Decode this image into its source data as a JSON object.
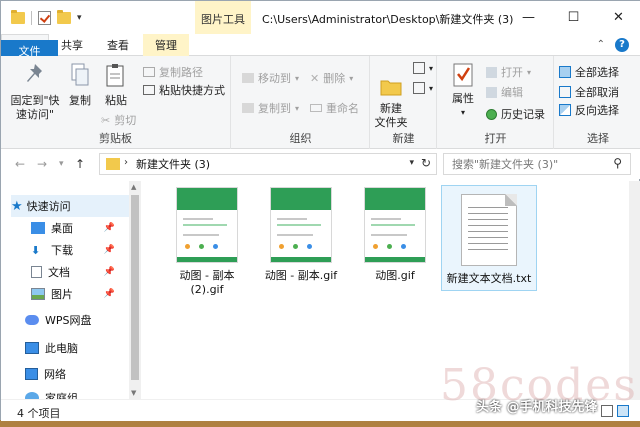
{
  "titlebar": {
    "context_tab": "图片工具",
    "path": "C:\\Users\\Administrator\\Desktop\\新建文件夹 (3)",
    "minimize": "—",
    "maximize": "☐",
    "close": "✕"
  },
  "tabs": [
    {
      "label": "文件"
    },
    {
      "label": "主页"
    },
    {
      "label": "共享"
    },
    {
      "label": "查看"
    },
    {
      "label": "管理"
    }
  ],
  "ribbon": {
    "clipboard": {
      "label": "剪贴板",
      "pin_quick_access": "固定到\"快速访问\"",
      "copy": "复制",
      "paste": "粘贴",
      "copy_path": "复制路径",
      "paste_shortcut": "粘贴快捷方式",
      "cut": "剪切"
    },
    "organize": {
      "label": "组织",
      "move_to": "移动到",
      "copy_to": "复制到",
      "delete": "删除",
      "rename": "重命名"
    },
    "new": {
      "label": "新建",
      "new_folder": "新建\n文件夹"
    },
    "open": {
      "label": "打开",
      "properties": "属性",
      "open": "打开",
      "edit": "编辑",
      "history": "历史记录"
    },
    "select": {
      "label": "选择",
      "select_all": "全部选择",
      "select_none": "全部取消",
      "invert": "反向选择"
    }
  },
  "address": {
    "path": "新建文件夹 (3)",
    "search_placeholder": "搜索\"新建文件夹 (3)\""
  },
  "navpane": {
    "items": [
      {
        "label": "快速访问",
        "icon": "star-icon"
      },
      {
        "label": "桌面",
        "icon": "desktop-icon"
      },
      {
        "label": "下载",
        "icon": "download-icon"
      },
      {
        "label": "文档",
        "icon": "document-icon"
      },
      {
        "label": "图片",
        "icon": "picture-icon"
      },
      {
        "label": "WPS网盘",
        "icon": "cloud-icon"
      },
      {
        "label": "此电脑",
        "icon": "computer-icon"
      },
      {
        "label": "网络",
        "icon": "network-icon"
      },
      {
        "label": "家庭组",
        "icon": "homegroup-icon"
      }
    ]
  },
  "files": [
    {
      "name": "动图 - 副本\n(2).gif",
      "type": "gif"
    },
    {
      "name": "动图 - 副本.gif",
      "type": "gif"
    },
    {
      "name": "动图.gif",
      "type": "gif"
    },
    {
      "name": "新建文本文档.txt",
      "type": "txt"
    }
  ],
  "status": {
    "count": "4 个项目"
  },
  "watermark": {
    "text": "头条 @手机科技先锋",
    "faint": "58codes"
  },
  "colors": {
    "accent": "#1979ca",
    "context_tab": "#fff4c8",
    "thumb_green": "#2e9e56"
  }
}
